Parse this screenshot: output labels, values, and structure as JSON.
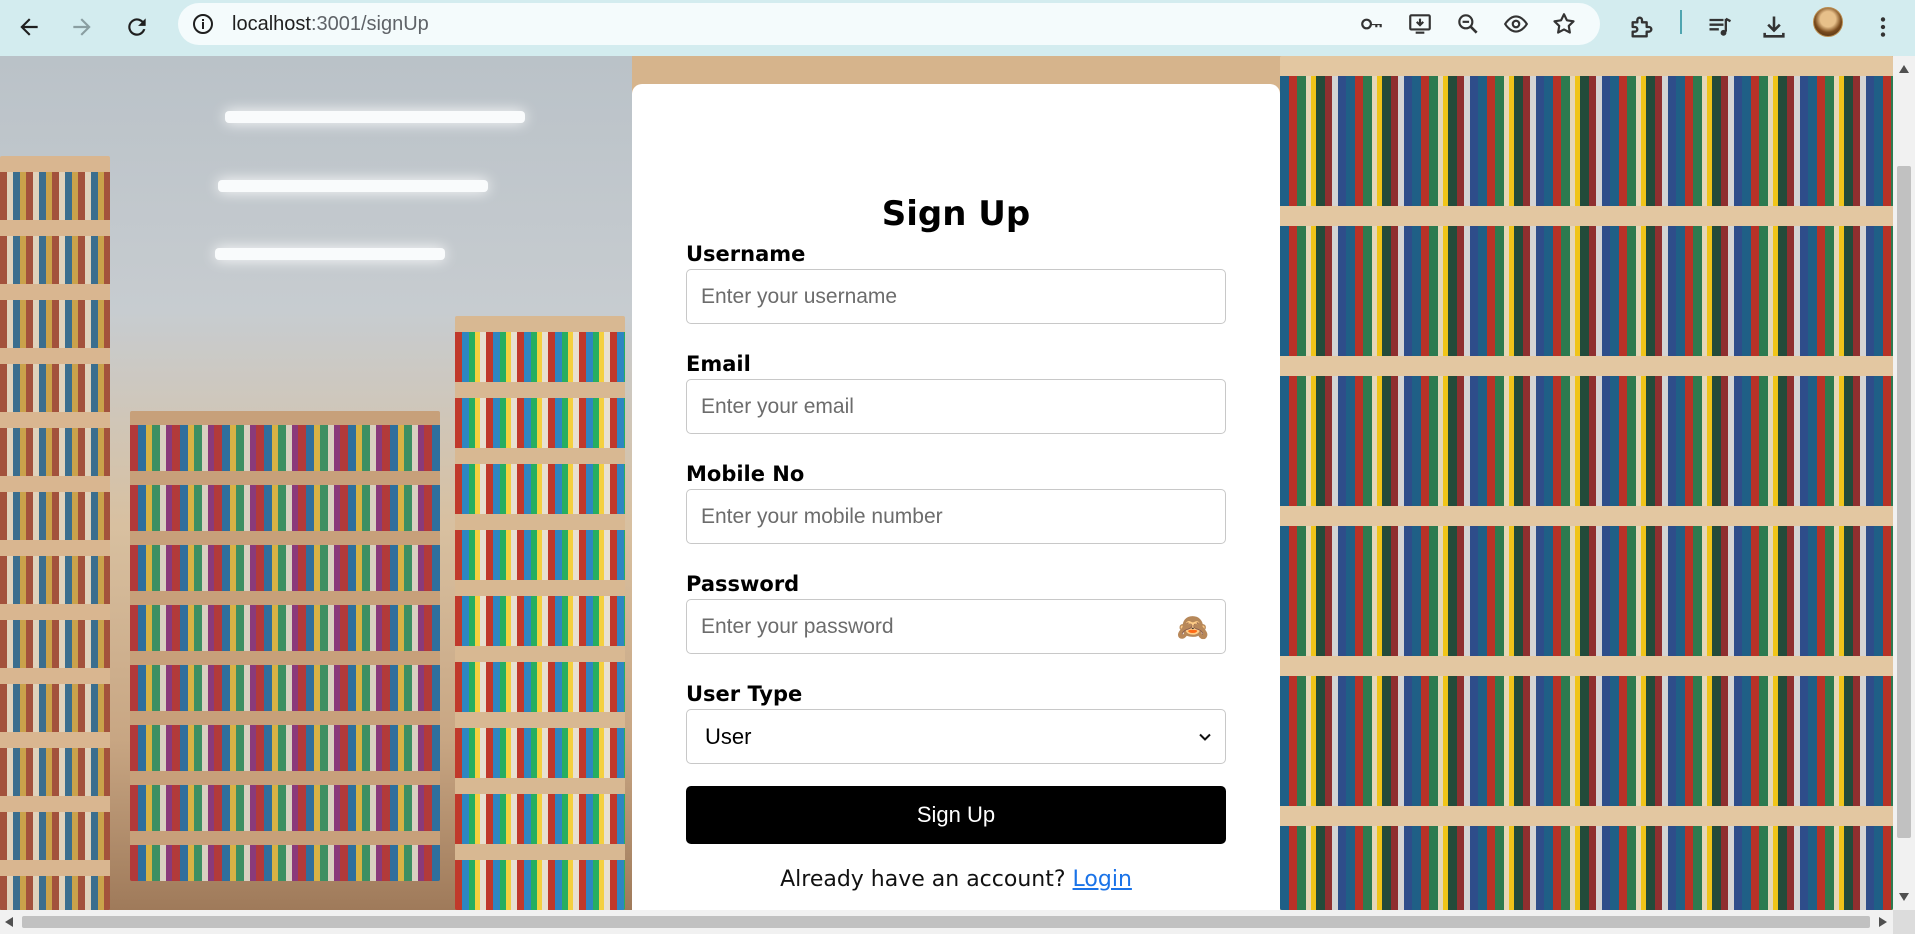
{
  "browser": {
    "url_host": "localhost",
    "url_path": ":3001/signUp"
  },
  "form": {
    "title": "Sign Up",
    "username": {
      "label": "Username",
      "placeholder": "Enter your username"
    },
    "email": {
      "label": "Email",
      "placeholder": "Enter your email"
    },
    "mobile": {
      "label": "Mobile No",
      "placeholder": "Enter your mobile number"
    },
    "password": {
      "label": "Password",
      "placeholder": "Enter your password",
      "toggle_icon": "🙈"
    },
    "user_type": {
      "label": "User Type",
      "selected": "User"
    },
    "submit_label": "Sign Up",
    "login_prompt": "Already have an account?",
    "login_link": "Login"
  },
  "colors": {
    "chrome_bg": "#d3ecef",
    "button_bg": "#000000",
    "link": "#1a73e8"
  }
}
